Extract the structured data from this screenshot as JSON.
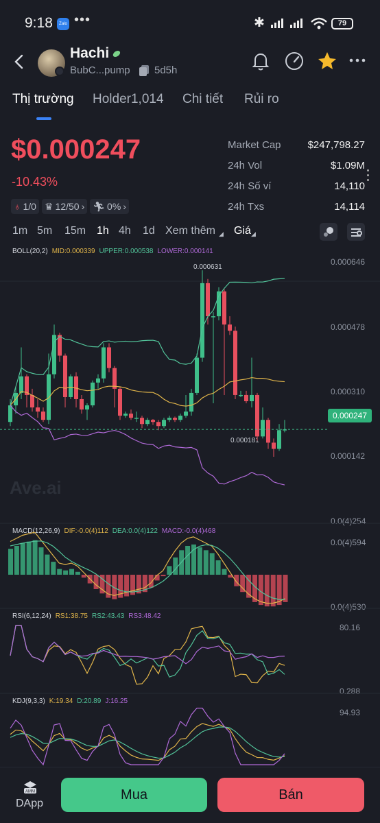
{
  "status_bar": {
    "time": "9:18",
    "zalo_label": "Zalo",
    "dots": "•••",
    "battery": "79"
  },
  "token": {
    "name": "Hachi",
    "address_short": "BubC...pump",
    "age": "5d5h",
    "price": "$0.000247",
    "change": "-10.43%"
  },
  "tabs": [
    {
      "label": "Thị trường",
      "active": true
    },
    {
      "label": "Holder1,014",
      "active": false
    },
    {
      "label": "Chi tiết",
      "active": false
    },
    {
      "label": "Rủi ro",
      "active": false
    }
  ],
  "chips": [
    {
      "icon": "money-bag-icon",
      "text": "1/0",
      "accent": "#f04e5d"
    },
    {
      "icon": "crown-icon",
      "text": "12/50",
      "chevron": "›"
    },
    {
      "icon": "runner-icon",
      "text": "0%",
      "chevron": "›"
    }
  ],
  "stats": [
    {
      "label": "Market Cap",
      "value": "$247,798.27"
    },
    {
      "label": "24h Vol",
      "value": "$1.09M"
    },
    {
      "label": "24h Số ví",
      "value": "14,110"
    },
    {
      "label": "24h Txs",
      "value": "14,114"
    }
  ],
  "intervals": [
    {
      "label": "1m",
      "active": false
    },
    {
      "label": "5m",
      "active": false
    },
    {
      "label": "15m",
      "active": false
    },
    {
      "label": "1h",
      "active": true
    },
    {
      "label": "4h",
      "active": false
    },
    {
      "label": "1d",
      "active": false
    },
    {
      "label": "Xem thêm",
      "active": false
    },
    {
      "label": "Giá",
      "active": true
    }
  ],
  "chart": {
    "boll": {
      "label": "BOLL(20,2)",
      "mid": "MID:0.000339",
      "upper": "UPPER:0.000538",
      "lower": "LOWER:0.000141"
    },
    "price_axis": [
      "0.000646",
      "0.000478",
      "0.000310",
      "0.000142",
      "0.0(4)254"
    ],
    "current_price": "0.000247",
    "high_label": "0.000631",
    "low_label": "0.000181",
    "watermark": "Ave.ai",
    "macd": {
      "label": "MACD(12,26,9)",
      "dif": "DIF:-0.0(4)112",
      "dea": "DEA:0.0(4)122",
      "macd": "MACD:-0.0(4)468",
      "axis_top": "0.0(4)594",
      "axis_bottom": "0.0(4)530"
    },
    "rsi": {
      "label": "RSI(6,12,24)",
      "rs1": "RS1:38.75",
      "rs2": "RS2:43.43",
      "rs3": "RS3:48.42",
      "axis_top": "80.16",
      "axis_bottom": "0.288"
    },
    "kdj": {
      "label": "KDJ(9,3,3)",
      "k": "K:19.34",
      "d": "D:20.89",
      "j": "J:16.25",
      "axis_top": "94.93"
    },
    "colors": {
      "up": "#3fbf8a",
      "down": "#e8505f",
      "mid": "#e1b54a",
      "upper": "#52c49a",
      "lower": "#b06ad8"
    },
    "candles": [
      [
        0.000265,
        0.000305,
        0.000255,
        0.00032
      ],
      [
        0.000305,
        0.000335,
        0.000285,
        0.00035
      ],
      [
        0.000335,
        0.000375,
        0.00032,
        0.000445
      ],
      [
        0.000375,
        0.00033,
        0.0003,
        0.00038
      ],
      [
        0.00033,
        0.0003,
        0.00029,
        0.000345
      ],
      [
        0.0003,
        0.00029,
        0.000275,
        0.00032
      ],
      [
        0.00029,
        0.00027,
        0.000265,
        0.0003
      ],
      [
        0.00027,
        0.00038,
        0.00026,
        0.00043
      ],
      [
        0.00038,
        0.000475,
        0.00037,
        0.0005
      ],
      [
        0.000475,
        0.000425,
        0.00041,
        0.00048
      ],
      [
        0.000425,
        0.000325,
        0.0003,
        0.00043
      ],
      [
        0.000325,
        0.000375,
        0.00032,
        0.00038
      ],
      [
        0.000375,
        0.00032,
        0.0003,
        0.000385
      ],
      [
        0.00032,
        0.000295,
        0.000285,
        0.00033
      ],
      [
        0.000295,
        0.000305,
        0.00027,
        0.00031
      ],
      [
        0.000305,
        0.00036,
        0.0003,
        0.000365
      ],
      [
        0.00036,
        0.00037,
        0.000345,
        0.00038
      ],
      [
        0.00037,
        0.000445,
        0.00036,
        0.000455
      ],
      [
        0.000445,
        0.000395,
        0.000385,
        0.000455
      ],
      [
        0.000395,
        0.000345,
        0.0003,
        0.0004
      ],
      [
        0.000345,
        0.00028,
        0.00027,
        0.00035
      ],
      [
        0.00028,
        0.000285,
        0.000275,
        0.00029
      ],
      [
        0.000285,
        0.000275,
        0.00027,
        0.000295
      ],
      [
        0.000275,
        0.000275,
        0.000265,
        0.00029
      ],
      [
        0.000275,
        0.00026,
        0.00025,
        0.00028
      ],
      [
        0.00026,
        0.00027,
        0.000255,
        0.000275
      ],
      [
        0.00027,
        0.000265,
        0.000258,
        0.000272
      ],
      [
        0.000265,
        0.000255,
        0.000245,
        0.00027
      ],
      [
        0.000255,
        0.00027,
        0.00025,
        0.000275
      ],
      [
        0.00027,
        0.000275,
        0.000265,
        0.00028
      ],
      [
        0.000275,
        0.00027,
        0.000265,
        0.000278
      ],
      [
        0.00027,
        0.00028,
        0.000265,
        0.000285
      ],
      [
        0.00028,
        0.00029,
        0.000275,
        0.00033
      ],
      [
        0.00029,
        0.000335,
        0.00028,
        0.000345
      ],
      [
        0.000335,
        0.00042,
        0.00033,
        0.00043
      ],
      [
        0.00042,
        0.0006,
        0.00041,
        0.000631
      ],
      [
        0.0006,
        0.00052,
        0.0005,
        0.00061
      ],
      [
        0.00052,
        0.00052,
        0.00031,
        0.00053
      ],
      [
        0.00052,
        0.00058,
        0.00051,
        0.00059
      ],
      [
        0.00058,
        0.0005,
        0.00033,
        0.000585
      ],
      [
        0.0005,
        0.000485,
        0.000475,
        0.00052
      ],
      [
        0.000485,
        0.00033,
        0.00032,
        0.000495
      ],
      [
        0.00033,
        0.00033,
        0.000325,
        0.00034
      ],
      [
        0.00033,
        0.000315,
        0.00031,
        0.00034
      ],
      [
        0.000315,
        0.00033,
        0.0003,
        0.00042
      ],
      [
        0.00033,
        0.00023,
        0.00022,
        0.000335
      ],
      [
        0.00023,
        0.00027,
        0.000225,
        0.0003
      ],
      [
        0.00027,
        0.000215,
        0.0002,
        0.000275
      ],
      [
        0.000215,
        0.0002,
        0.000181,
        0.000225
      ],
      [
        0.0002,
        0.000245,
        0.000195,
        0.00026
      ],
      [
        0.000245,
        0.000247,
        0.00024,
        0.00027
      ]
    ],
    "macd_hist": [
      0.9,
      1.0,
      1.1,
      1.15,
      1.2,
      0.95,
      0.7,
      0.45,
      0.2,
      0.15,
      0.2,
      0.1,
      -0.1,
      -0.3,
      -0.5,
      -0.65,
      -0.8,
      -0.85,
      -0.8,
      -0.75,
      -0.7,
      -0.65,
      -0.6,
      -0.45,
      -0.2,
      -0.05,
      0.3,
      0.6,
      0.85,
      1.0,
      1.05,
      0.95,
      0.85,
      0.75,
      0.5,
      0.2,
      -0.1,
      -0.4,
      -0.6,
      -0.8,
      -0.95,
      -1.05,
      -1.1,
      -1.1,
      -1.05,
      -0.95
    ]
  },
  "actions": {
    "dapp_badge": "AMM",
    "dapp_label": "DApp",
    "buy": "Mua",
    "sell": "Bán"
  }
}
